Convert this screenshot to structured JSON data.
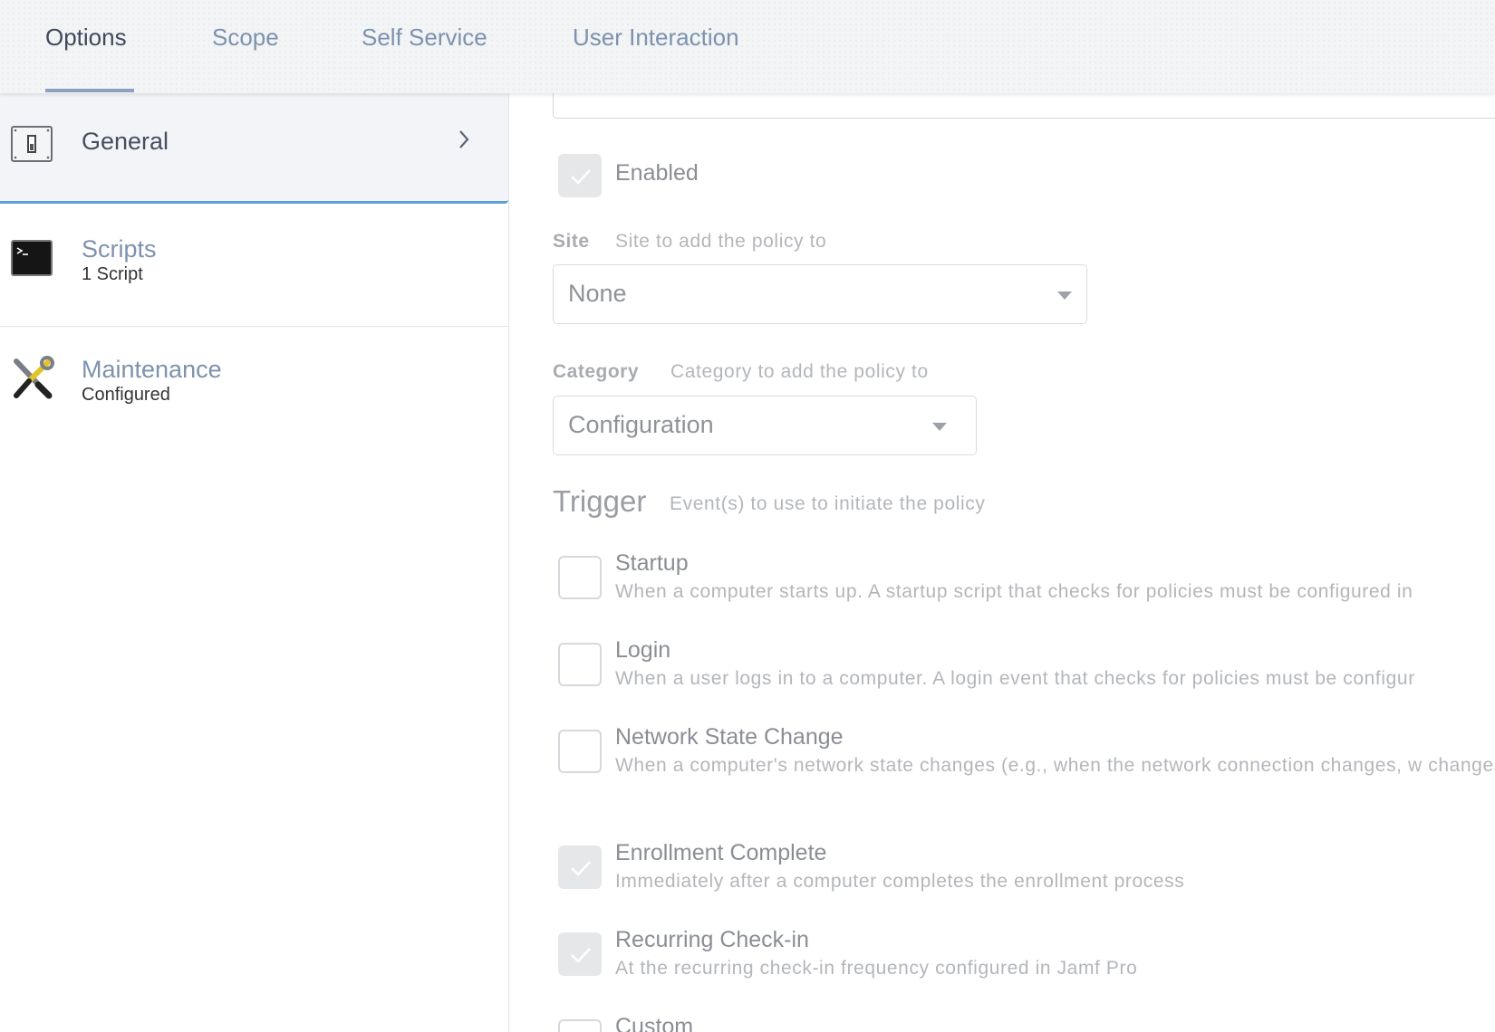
{
  "tabs": [
    {
      "label": "Options",
      "active": true
    },
    {
      "label": "Scope",
      "active": false
    },
    {
      "label": "Self Service",
      "active": false
    },
    {
      "label": "User Interaction",
      "active": false
    }
  ],
  "sidebar": {
    "items": [
      {
        "title": "General",
        "subtitle": "",
        "icon": "switch-panel-icon",
        "selected": true
      },
      {
        "title": "Scripts",
        "subtitle": "1 Script",
        "icon": "terminal-icon",
        "selected": false
      },
      {
        "title": "Maintenance",
        "subtitle": "Configured",
        "icon": "tools-icon",
        "selected": false
      }
    ]
  },
  "form": {
    "enabled": {
      "label": "Enabled",
      "checked": true
    },
    "site": {
      "label": "Site",
      "hint": "Site to add the policy to",
      "value": "None"
    },
    "category": {
      "label": "Category",
      "hint": "Category to add the policy to",
      "value": "Configuration"
    },
    "trigger": {
      "title": "Trigger",
      "hint": "Event(s) to use to initiate the policy",
      "options": [
        {
          "label": "Startup",
          "desc": "When a computer starts up. A startup script that checks for policies must be configured in",
          "checked": false
        },
        {
          "label": "Login",
          "desc": "When a user logs in to a computer. A login event that checks for policies must be configur",
          "checked": false
        },
        {
          "label": "Network State Change",
          "desc": "When a computer's network state changes (e.g., when the network connection changes, w changes)",
          "checked": false
        },
        {
          "label": "Enrollment Complete",
          "desc": "Immediately after a computer completes the enrollment process",
          "checked": true
        },
        {
          "label": "Recurring Check-in",
          "desc": "At the recurring check-in frequency configured in Jamf Pro",
          "checked": true
        },
        {
          "label": "Custom",
          "desc": "",
          "checked": false
        }
      ]
    }
  },
  "colors": {
    "tab_active": "#3f4a5c",
    "tab_inactive": "#7d92ad",
    "selection_accent": "#5b9fd8"
  }
}
